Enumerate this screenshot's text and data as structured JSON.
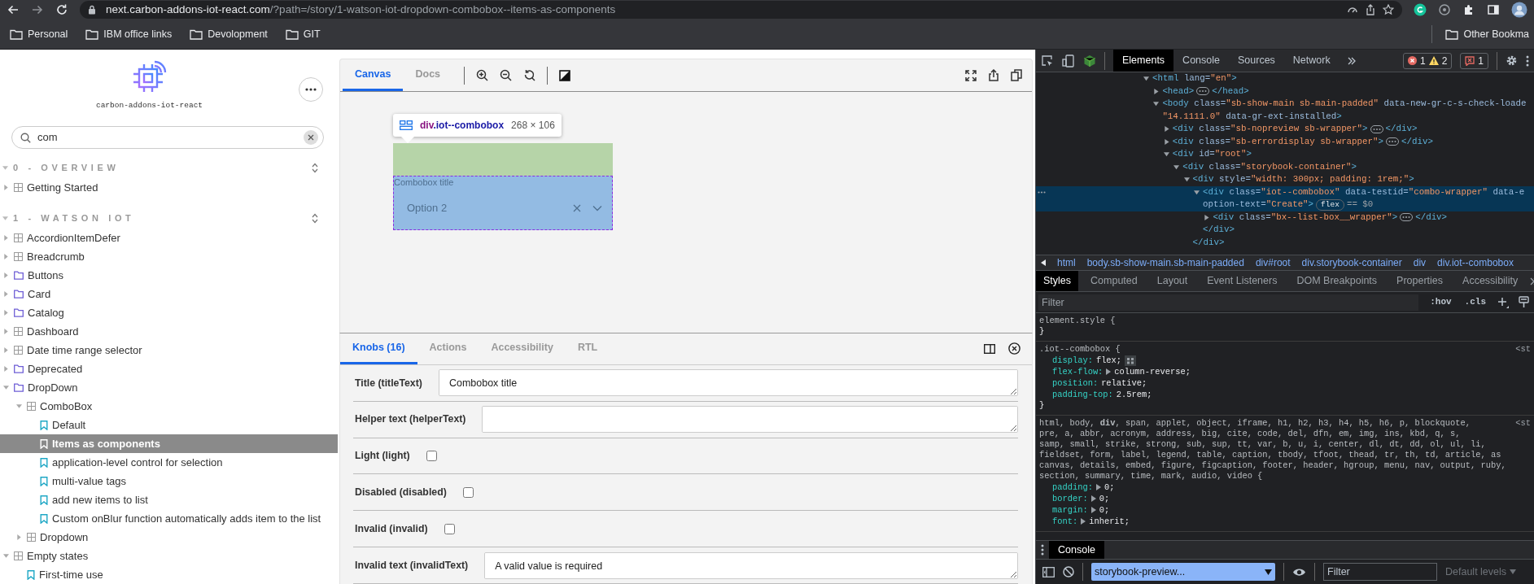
{
  "browser": {
    "url_host": "next.carbon-addons-iot-react.com",
    "url_path": "/?path=/story/1-watson-iot-dropdown-combobox--items-as-components",
    "bookmarks": [
      {
        "label": "Personal"
      },
      {
        "label": "IBM office links"
      },
      {
        "label": "Devolopment"
      },
      {
        "label": "GIT"
      }
    ],
    "other_bookmarks": "Other Bookma"
  },
  "sidebar": {
    "brand": "carbon-addons-iot-react",
    "search": {
      "value": "com"
    },
    "sections": [
      {
        "title": "0 - OVERVIEW",
        "expanded": true,
        "items": [
          {
            "label": "Getting Started",
            "kind": "component",
            "expanded": false,
            "selected": false
          }
        ]
      },
      {
        "title": "1 - WATSON IOT",
        "expanded": true,
        "items": [
          {
            "label": "AccordionItemDefer",
            "kind": "component",
            "expanded": false,
            "selected": false
          },
          {
            "label": "Breadcrumb",
            "kind": "component",
            "expanded": false,
            "selected": false
          },
          {
            "label": "Buttons",
            "kind": "folder",
            "expanded": false,
            "selected": false
          },
          {
            "label": "Card",
            "kind": "folder",
            "expanded": false,
            "selected": false
          },
          {
            "label": "Catalog",
            "kind": "folder",
            "expanded": false,
            "selected": false
          },
          {
            "label": "Dashboard",
            "kind": "component",
            "expanded": false,
            "selected": false
          },
          {
            "label": "Date time range selector",
            "kind": "component",
            "expanded": false,
            "selected": false
          },
          {
            "label": "Deprecated",
            "kind": "folder",
            "expanded": false,
            "selected": false
          },
          {
            "label": "DropDown",
            "kind": "folder",
            "expanded": true,
            "selected": false,
            "children": [
              {
                "label": "ComboBox",
                "kind": "component",
                "expanded": true,
                "selected": false,
                "children": [
                  {
                    "label": "Default",
                    "kind": "story",
                    "selected": false
                  },
                  {
                    "label": "Items as components",
                    "kind": "story",
                    "selected": true
                  },
                  {
                    "label": "application-level control for selection",
                    "kind": "story",
                    "selected": false
                  },
                  {
                    "label": "multi-value tags",
                    "kind": "story",
                    "selected": false
                  },
                  {
                    "label": "add new items to list",
                    "kind": "story",
                    "selected": false
                  },
                  {
                    "label": "Custom onBlur function automatically adds item to the list",
                    "kind": "story",
                    "selected": false
                  }
                ]
              },
              {
                "label": "Dropdown",
                "kind": "component",
                "expanded": false,
                "selected": false
              }
            ]
          },
          {
            "label": "Empty states",
            "kind": "component",
            "expanded": true,
            "selected": false,
            "children": [
              {
                "label": "First-time use",
                "kind": "story",
                "selected": false
              }
            ]
          }
        ]
      }
    ]
  },
  "canvas": {
    "tabs": [
      {
        "label": "Canvas",
        "selected": true
      },
      {
        "label": "Docs",
        "selected": false
      }
    ],
    "inspect_tooltip": {
      "tag": "div",
      "class_name": ".iot--combobox",
      "size": "268 × 106"
    },
    "combobox": {
      "title": "Combobox title",
      "value": "Option 2"
    }
  },
  "addons": {
    "tabs": [
      {
        "label": "Knobs (16)",
        "selected": true
      },
      {
        "label": "Actions",
        "selected": false
      },
      {
        "label": "Accessibility",
        "selected": false
      },
      {
        "label": "RTL",
        "selected": false
      }
    ],
    "knobs": [
      {
        "kind": "text",
        "label": "Title (titleText)",
        "value": "Combobox title"
      },
      {
        "kind": "text",
        "label": "Helper text (helperText)"
      },
      {
        "kind": "checkbox",
        "label": "Light (light)",
        "checked": false
      },
      {
        "kind": "checkbox",
        "label": "Disabled (disabled)",
        "checked": false
      },
      {
        "kind": "checkbox",
        "label": "Invalid (invalid)",
        "checked": false
      },
      {
        "kind": "text",
        "label": "Invalid text (invalidText)",
        "value": "A valid value is required"
      }
    ]
  },
  "devtools": {
    "tabs": [
      {
        "label": "Elements",
        "selected": true
      },
      {
        "label": "Console",
        "selected": false
      },
      {
        "label": "Sources",
        "selected": false
      },
      {
        "label": "Network",
        "selected": false
      }
    ],
    "errors": "1",
    "warnings": "2",
    "issues": "1",
    "dom": [
      {
        "lines": [
          "<html lang=\"en\">"
        ],
        "expanded": true,
        "selected": false,
        "children": [
          {
            "lines": [
              "<head>"
            ],
            "close": "</head>",
            "expanded": false,
            "selected": false
          },
          {
            "lines": [
              "<body class=\"sb-show-main sb-main-padded\" data-new-gr-c-s-check-loade",
              "\"14.1111.0\" data-gr-ext-installed>"
            ],
            "expanded": true,
            "selected": false,
            "children": [
              {
                "lines": [
                  "<div class=\"sb-nopreview sb-wrapper\">"
                ],
                "close": "</div>",
                "expanded": false,
                "selected": false
              },
              {
                "lines": [
                  "<div class=\"sb-errordisplay sb-wrapper\">"
                ],
                "close": "</div>",
                "expanded": false,
                "selected": false
              },
              {
                "lines": [
                  "<div id=\"root\">"
                ],
                "expanded": true,
                "selected": false,
                "children": [
                  {
                    "lines": [
                      "<div class=\"storybook-container\">"
                    ],
                    "expanded": true,
                    "selected": false,
                    "children": [
                      {
                        "lines": [
                          "<div style=\"width: 300px; padding: 1rem;\">"
                        ],
                        "expanded": true,
                        "selected": false,
                        "close": "</div>",
                        "children": [
                          {
                            "lines": [
                              "<div class=\"iot--combobox\" data-testid=\"combo-wrapper\" data-e",
                              "option-text=\"Create\">"
                            ],
                            "badge": "flex",
                            "suffix": "== $0",
                            "expanded": true,
                            "selected": true,
                            "close": "</div>",
                            "children": [
                              {
                                "lines": [
                                  "<div class=\"bx--list-box__wrapper\">"
                                ],
                                "close": "</div>",
                                "expanded": false,
                                "selected": false
                              }
                            ]
                          }
                        ]
                      }
                    ]
                  }
                ]
              }
            ]
          }
        ]
      }
    ],
    "breadcrumbs": [
      {
        "label": "html"
      },
      {
        "label": "body.sb-show-main.sb-main-padded"
      },
      {
        "label": "div#root"
      },
      {
        "label": "div.storybook-container"
      },
      {
        "label": "div"
      },
      {
        "label": "div.iot--combobox"
      }
    ],
    "style_tabs": [
      {
        "label": "Styles",
        "selected": true
      },
      {
        "label": "Computed",
        "selected": false
      },
      {
        "label": "Layout",
        "selected": false
      },
      {
        "label": "Event Listeners",
        "selected": false
      },
      {
        "label": "DOM Breakpoints",
        "selected": false
      },
      {
        "label": "Properties",
        "selected": false
      },
      {
        "label": "Accessibility",
        "selected": false
      }
    ],
    "filter": {
      "placeholder": "Filter"
    },
    "hov": ":hov",
    "cls": ".cls",
    "rules": [
      {
        "selector_lines": [
          "element.style {"
        ],
        "close": "}"
      },
      {
        "selector_lines": [
          ".iot--combobox {"
        ],
        "source": "<st",
        "declarations": [
          {
            "property": "display:",
            "value": "flex;",
            "flex_editor": true
          },
          {
            "property": "flex-flow:",
            "value": "column-reverse;",
            "expandable": true
          },
          {
            "property": "position:",
            "value": "relative;"
          },
          {
            "property": "padding-top:",
            "value": "2.5rem;"
          }
        ],
        "close": "}"
      },
      {
        "selector_lines": [
          "html, body, **div**, span, applet, object, iframe, h1, h2, h3, h4, h5, h6, p, blockquote,",
          "pre, a, abbr, acronym, address, big, cite, code, del, dfn, em, img, ins, kbd, q, s,",
          "samp, small, strike, strong, sub, sup, tt, var, b, u, i, center, dl, dt, dd, ol, ul, li,",
          "fieldset, form, label, legend, table, caption, tbody, tfoot, thead, tr, th, td, article, as",
          "canvas, details, embed, figure, figcaption, footer, header, hgroup, menu, nav, output, ruby,",
          "section, summary, time, mark, audio, video {"
        ],
        "source": "<st",
        "declarations": [
          {
            "property": "padding:",
            "value": "0;",
            "expandable": true
          },
          {
            "property": "border:",
            "value": "0;",
            "expandable": true
          },
          {
            "property": "margin:",
            "value": "0;",
            "expandable": true
          },
          {
            "property": "font:",
            "value": "inherit;",
            "expandable": true
          }
        ]
      }
    ],
    "drawer": {
      "tabs": [
        {
          "label": "Console",
          "selected": true
        }
      ],
      "context": "storybook-preview...",
      "filter": {
        "placeholder": "Filter"
      },
      "levels": "Default levels"
    }
  }
}
